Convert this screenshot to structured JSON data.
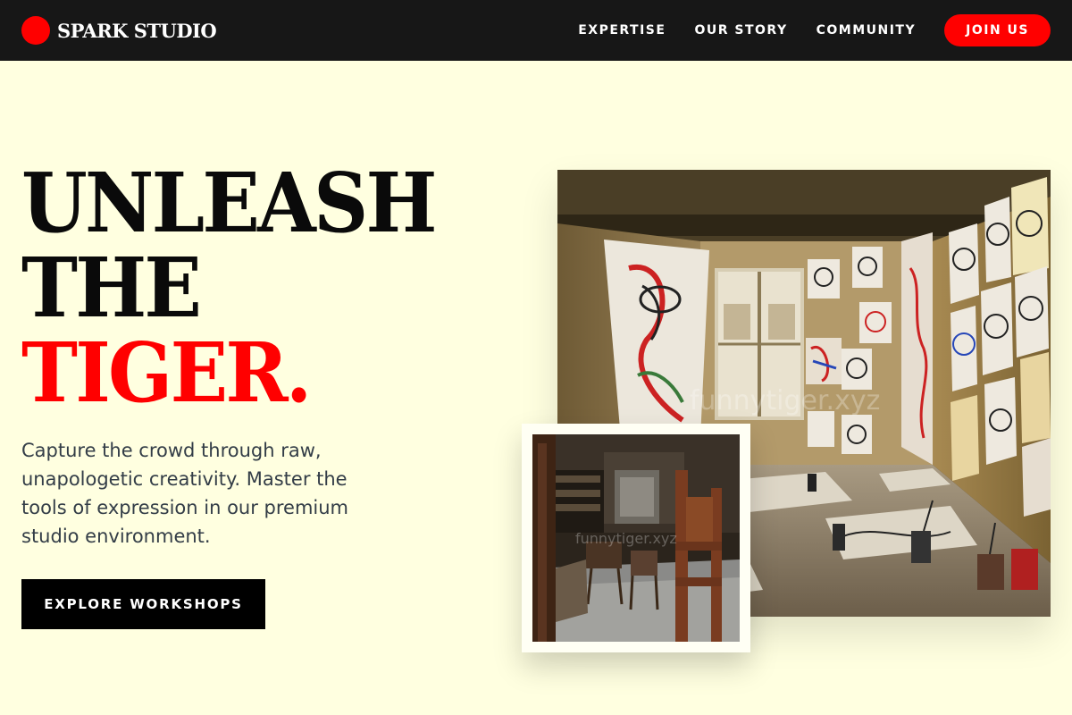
{
  "brand": {
    "name": "SPARK STUDIO",
    "logo_color": "#ff0000"
  },
  "nav": {
    "links": [
      "EXPERTISE",
      "OUR STORY",
      "COMMUNITY"
    ],
    "cta": "JOIN US"
  },
  "hero": {
    "headline_lines": [
      "UNLEASH",
      "THE",
      "TIGER."
    ],
    "accent_color": "#ff0000",
    "subcopy": "Capture the crowd through raw, unapologetic creativity. Master the tools of expression in our premium studio environment.",
    "cta": "EXPLORE WORKSHOPS"
  },
  "images": {
    "main": {
      "watermark": "funnytiger.xyz",
      "icon": "art-studio-photo"
    },
    "secondary": {
      "watermark": "funnytiger.xyz",
      "icon": "workshop-easels-photo"
    }
  }
}
